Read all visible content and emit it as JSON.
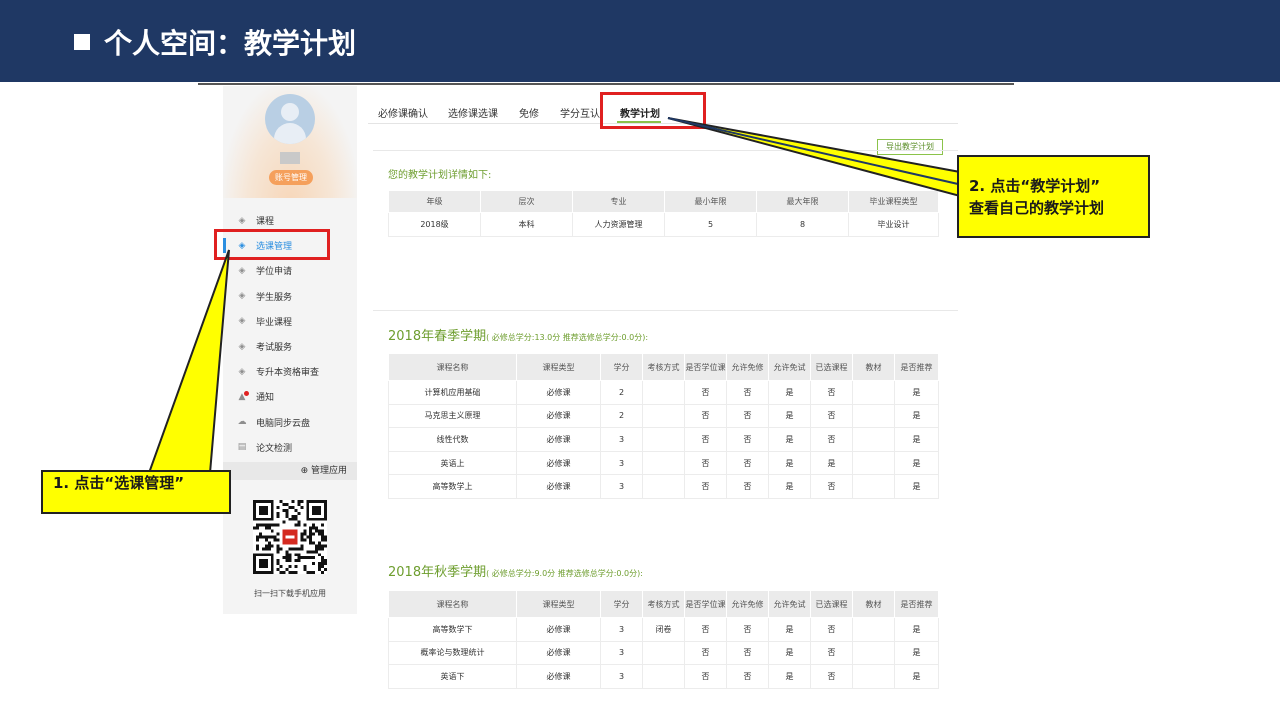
{
  "header": {
    "title": "个人空间：教学计划"
  },
  "sidebar": {
    "account_button": "账号管理",
    "items": [
      {
        "label": "课程",
        "icon": "graduation-cap-icon"
      },
      {
        "label": "选课管理",
        "icon": "graduation-cap-icon"
      },
      {
        "label": "学位申请",
        "icon": "graduation-cap-icon"
      },
      {
        "label": "学生服务",
        "icon": "graduation-cap-icon"
      },
      {
        "label": "毕业课程",
        "icon": "graduation-cap-icon"
      },
      {
        "label": "考试服务",
        "icon": "graduation-cap-icon"
      },
      {
        "label": "专升本资格审查",
        "icon": "graduation-cap-icon"
      },
      {
        "label": "通知",
        "icon": "bell-icon"
      },
      {
        "label": "电脑同步云盘",
        "icon": "cloud-icon"
      },
      {
        "label": "论文检测",
        "icon": "document-search-icon"
      }
    ],
    "active_index": 1,
    "manage_apps": "管理应用",
    "qr_caption": "扫一扫下载手机应用"
  },
  "tabs": [
    "必修课确认",
    "选修课选课",
    "免修",
    "学分互认",
    "教学计划"
  ],
  "active_tab": "教学计划",
  "export_button": "导出教学计划",
  "plan": {
    "intro": "您的教学计划详情如下:",
    "headers": [
      "年级",
      "层次",
      "专业",
      "最小年限",
      "最大年限",
      "毕业课程类型"
    ],
    "row": [
      "2018级",
      "本科",
      "人力资源管理",
      "5",
      "8",
      "毕业设计"
    ]
  },
  "course_headers": [
    "课程名称",
    "课程类型",
    "学分",
    "考核方式",
    "是否学位课",
    "允许免修",
    "允许免试",
    "已选课程",
    "教材",
    "是否推荐"
  ],
  "semesters": [
    {
      "title": "2018年春季学期",
      "subtitle": "( 必修总学分:13.0分 推荐选修总学分:0.0分):",
      "rows": [
        [
          "计算机应用基础",
          "必修课",
          "2",
          "",
          "否",
          "否",
          "是",
          "否",
          "",
          "是"
        ],
        [
          "马克思主义原理",
          "必修课",
          "2",
          "",
          "否",
          "否",
          "是",
          "否",
          "",
          "是"
        ],
        [
          "线性代数",
          "必修课",
          "3",
          "",
          "否",
          "否",
          "是",
          "否",
          "",
          "是"
        ],
        [
          "英语上",
          "必修课",
          "3",
          "",
          "否",
          "否",
          "是",
          "是",
          "",
          "是"
        ],
        [
          "高等数学上",
          "必修课",
          "3",
          "",
          "否",
          "否",
          "是",
          "否",
          "",
          "是"
        ]
      ]
    },
    {
      "title": "2018年秋季学期",
      "subtitle": "( 必修总学分:9.0分 推荐选修总学分:0.0分):",
      "rows": [
        [
          "高等数学下",
          "必修课",
          "3",
          "闭卷",
          "否",
          "否",
          "是",
          "否",
          "",
          "是"
        ],
        [
          "概率论与数理统计",
          "必修课",
          "3",
          "",
          "否",
          "否",
          "是",
          "否",
          "",
          "是"
        ],
        [
          "英语下",
          "必修课",
          "3",
          "",
          "否",
          "否",
          "是",
          "否",
          "",
          "是"
        ]
      ]
    }
  ],
  "callouts": {
    "step1": "1. 点击“选课管理”",
    "step2_line1": "2. 点击“教学计划”",
    "step2_line2": "查看自己的教学计划"
  },
  "colors": {
    "header_bg": "#1f3864",
    "highlight": "#ffff00",
    "red_box": "#e02020",
    "accent_green": "#6e9e2f",
    "active_blue": "#2a8ee0"
  }
}
